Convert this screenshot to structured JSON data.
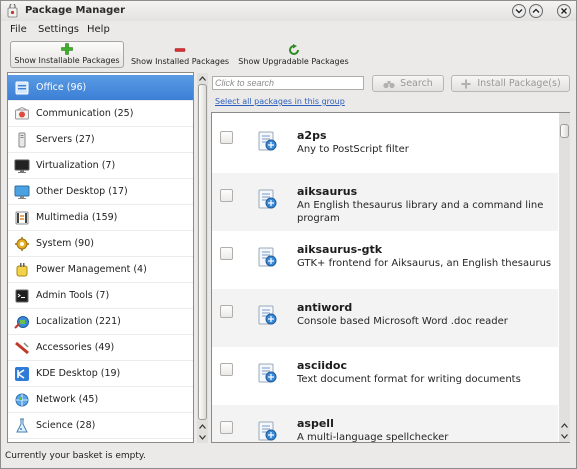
{
  "window": {
    "title": "Package Manager"
  },
  "menu": {
    "items": [
      "File",
      "Settings",
      "Help"
    ]
  },
  "toolbar": {
    "installable": "Show Installable Packages",
    "installed": "Show Installed Packages",
    "upgradable": "Show Upgradable Packages"
  },
  "categories": [
    {
      "label": "Office (96)",
      "icon": "office-icon",
      "selected": true
    },
    {
      "label": "Communication (25)",
      "icon": "communication-icon"
    },
    {
      "label": "Servers (27)",
      "icon": "servers-icon"
    },
    {
      "label": "Virtualization (7)",
      "icon": "virtualization-icon"
    },
    {
      "label": "Other Desktop (17)",
      "icon": "other-desktop-icon"
    },
    {
      "label": "Multimedia (159)",
      "icon": "multimedia-icon"
    },
    {
      "label": "System (90)",
      "icon": "system-icon"
    },
    {
      "label": "Power Management (4)",
      "icon": "power-management-icon"
    },
    {
      "label": "Admin Tools (7)",
      "icon": "admin-tools-icon"
    },
    {
      "label": "Localization (221)",
      "icon": "localization-icon"
    },
    {
      "label": "Accessories (49)",
      "icon": "accessories-icon"
    },
    {
      "label": "KDE Desktop (19)",
      "icon": "kde-desktop-icon"
    },
    {
      "label": "Network (45)",
      "icon": "network-icon"
    },
    {
      "label": "Science (28)",
      "icon": "science-icon"
    }
  ],
  "search": {
    "placeholder": "Click to search",
    "button": "Search"
  },
  "install_button": "Install Package(s)",
  "select_all": "Select all packages in this group",
  "packages": [
    {
      "name": "a2ps",
      "description": "Any to PostScript filter"
    },
    {
      "name": "aiksaurus",
      "description": "An English thesaurus library and a command line program"
    },
    {
      "name": "aiksaurus-gtk",
      "description": "GTK+ frontend for Aiksaurus, an English thesaurus"
    },
    {
      "name": "antiword",
      "description": "Console based Microsoft Word .doc reader"
    },
    {
      "name": "asciidoc",
      "description": "Text document format for writing documents"
    },
    {
      "name": "aspell",
      "description": "A multi-language spellchecker"
    }
  ],
  "status": "Currently your basket is empty.",
  "colors": {
    "selection": "#3b7fd6",
    "link": "#2b5fbf"
  }
}
